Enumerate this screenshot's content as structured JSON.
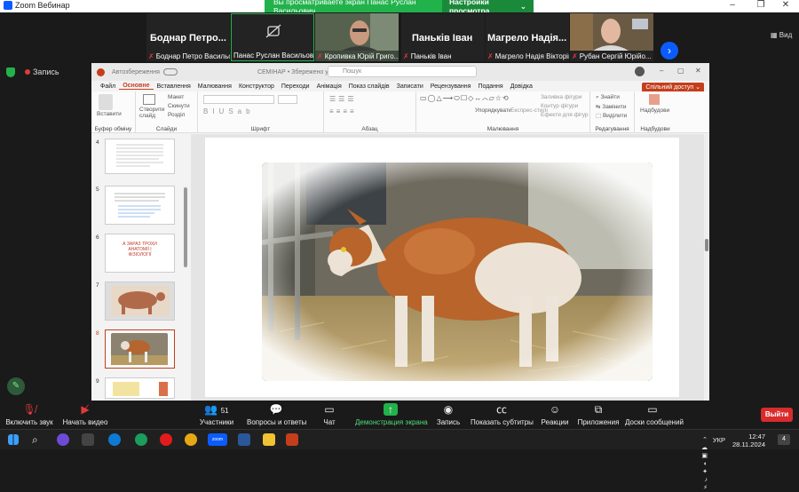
{
  "window": {
    "title": "Zoom Вебинар"
  },
  "banner": {
    "message": "Вы просматриваете экран Панас Руслан Васильович",
    "options": "Настройки просмотра"
  },
  "gallery": {
    "participants": [
      {
        "big_name": "Боднар Петро...",
        "label": "Боднар Петро Васильо..."
      },
      {
        "big_name": "",
        "label": "Панас Руслан Васильович"
      },
      {
        "big_name": "",
        "label": "Кропивка Юрій Григо..."
      },
      {
        "big_name": "Паньків Іван",
        "label": "Паньків Іван"
      },
      {
        "big_name": "Магрело Надія...",
        "label": "Магрело Надія Вікторів..."
      },
      {
        "big_name": "",
        "label": "Рубан Сергій Юрійо..."
      }
    ],
    "view_label": "Вид"
  },
  "recording": {
    "label": "Запись"
  },
  "ppt": {
    "autosave": "Автозбереження",
    "doc_title": "СЕМІНАР • Збережено у цей ПК",
    "search_placeholder": "Пошук",
    "menu": [
      "Файл",
      "Основне",
      "Вставлення",
      "Малювання",
      "Конструктор",
      "Переходи",
      "Анімація",
      "Показ слайдів",
      "Записати",
      "Рецензування",
      "Подання",
      "Довідка"
    ],
    "active_menu": "Основне",
    "share": "Спільний доступ",
    "ribbon": {
      "groups": [
        "Буфер обміну",
        "Слайди",
        "Шрифт",
        "Абзац",
        "Малювання",
        "Редагування",
        "Надбудови"
      ],
      "paste": "Вставити",
      "new_slide": "Створити слайд",
      "layout": "Макет",
      "reset": "Скинути",
      "section": "Розділ",
      "arrange": "Упорядкувати",
      "quick_styles": "Експрес-стилі",
      "fill": "Заливка фігури",
      "outline": "Контур фігури",
      "effects": "Ефекти для фігур",
      "find": "Знайти",
      "replace": "Замінити",
      "select": "Виділити",
      "addins": "Надбудови"
    },
    "thumbnails": [
      {
        "num": "4"
      },
      {
        "num": "5"
      },
      {
        "num": "6",
        "text": "А ЗАРАЗ ТРОХИ АНАТОМІЇ І ФІЗІОЛОГІЇ"
      },
      {
        "num": "7"
      },
      {
        "num": "8"
      },
      {
        "num": "9"
      }
    ]
  },
  "controls": [
    {
      "label": "Включить звук"
    },
    {
      "label": "Начать видео"
    },
    {
      "label": "Участники",
      "count": "51"
    },
    {
      "label": "Вопросы и ответы"
    },
    {
      "label": "Чат"
    },
    {
      "label": "Демонстрация экрана"
    },
    {
      "label": "Запись"
    },
    {
      "label": "Показать субтитры"
    },
    {
      "label": "Реакции"
    },
    {
      "label": "Приложения"
    },
    {
      "label": "Доски сообщений"
    }
  ],
  "exit": "Выйти",
  "taskbar": {
    "lang": "УКР",
    "time": "12:47",
    "date": "28.11.2024",
    "notif": "4"
  },
  "colors": {
    "zoom_blue": "#0b5cff",
    "share_green": "#22b24c",
    "ppt_accent": "#c43e1c",
    "exit_red": "#d92b2b"
  }
}
